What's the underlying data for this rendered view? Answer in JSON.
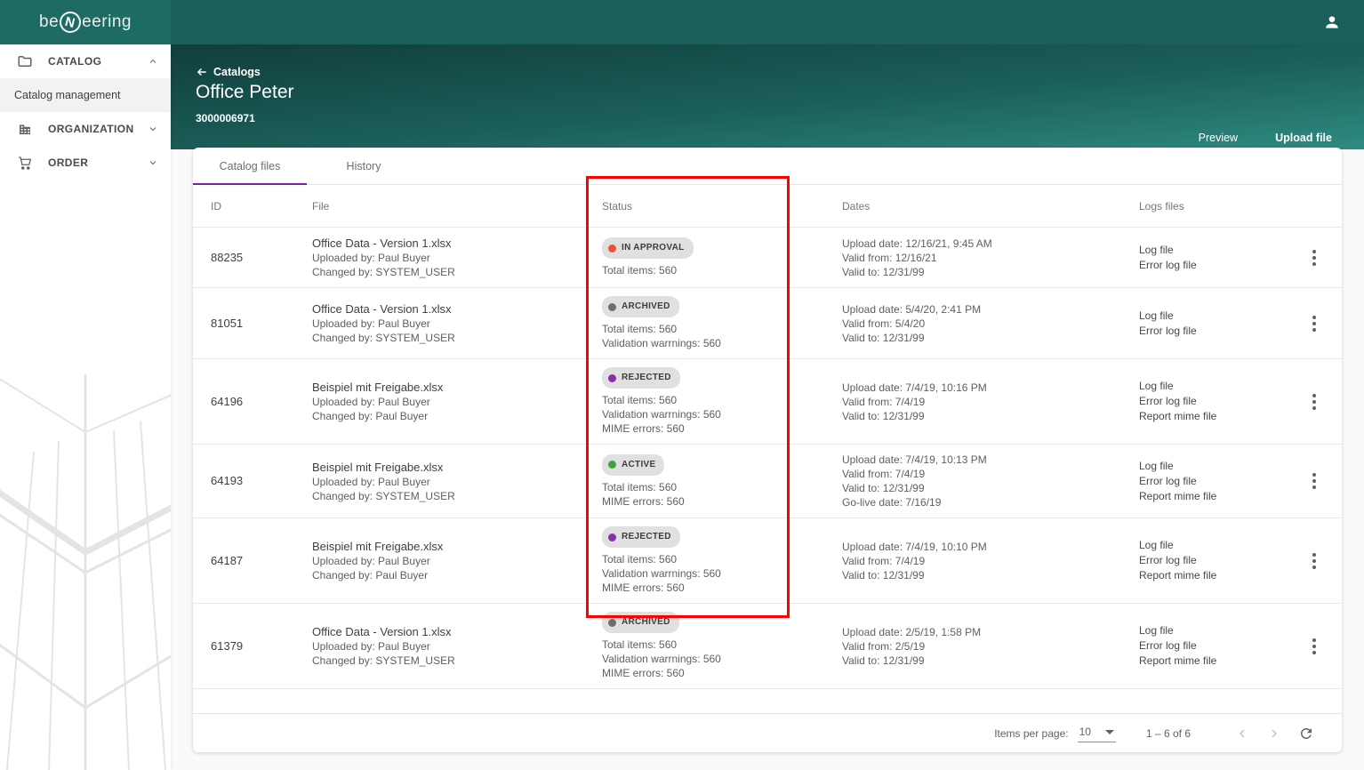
{
  "topbar": {
    "logo_pre": "be",
    "logo_mid": "N",
    "logo_post": "eering"
  },
  "sidebar": {
    "items": [
      {
        "label": "CATALOG",
        "icon": "folder-icon",
        "expanded": true
      },
      {
        "label": "Catalog management",
        "selected": true
      },
      {
        "label": "ORGANIZATION",
        "icon": "building-icon",
        "expanded": false
      },
      {
        "label": "ORDER",
        "icon": "cart-icon",
        "expanded": false
      }
    ]
  },
  "header": {
    "back_label": "Catalogs",
    "title": "Office Peter",
    "subtitle": "3000006971",
    "preview_label": "Preview",
    "upload_label": "Upload file"
  },
  "tabs": {
    "catalog_files": "Catalog files",
    "history": "History"
  },
  "table": {
    "columns": {
      "id": "ID",
      "file": "File",
      "status": "Status",
      "dates": "Dates",
      "logs": "Logs files"
    },
    "rows": [
      {
        "id": "88235",
        "file_name": "Office Data - Version 1.xlsx",
        "uploaded_by": "Uploaded by: Paul Buyer",
        "changed_by": "Changed by: SYSTEM_USER",
        "status_label": "IN APPROVAL",
        "status_color": "#E8542F",
        "status_details": [
          "Total items: 560"
        ],
        "dates": [
          "Upload date: 12/16/21, 9:45 AM",
          "Valid from: 12/16/21",
          "Valid to: 12/31/99"
        ],
        "logs": [
          "Log file",
          "Error log file"
        ]
      },
      {
        "id": "81051",
        "file_name": "Office Data - Version 1.xlsx",
        "uploaded_by": "Uploaded by: Paul Buyer",
        "changed_by": "Changed by: SYSTEM_USER",
        "status_label": "ARCHIVED",
        "status_color": "#6E6E6E",
        "status_details": [
          "Total items: 560",
          "Validation warrnings: 560"
        ],
        "dates": [
          "Upload date: 5/4/20, 2:41 PM",
          "Valid from: 5/4/20",
          "Valid to: 12/31/99"
        ],
        "logs": [
          "Log file",
          "Error log file"
        ]
      },
      {
        "id": "64196",
        "file_name": "Beispiel mit Freigabe.xlsx",
        "uploaded_by": "Uploaded by: Paul Buyer",
        "changed_by": "Changed by: Paul Buyer",
        "status_label": "REJECTED",
        "status_color": "#8B2FA8",
        "status_details": [
          "Total items: 560",
          "Validation warrnings: 560",
          "MIME errors: 560"
        ],
        "dates": [
          "Upload date: 7/4/19, 10:16 PM",
          "Valid from: 7/4/19",
          "Valid to: 12/31/99"
        ],
        "logs": [
          "Log file",
          "Error log file",
          "Report mime file"
        ]
      },
      {
        "id": "64193",
        "file_name": "Beispiel mit Freigabe.xlsx",
        "uploaded_by": "Uploaded by: Paul Buyer",
        "changed_by": "Changed by: SYSTEM_USER",
        "status_label": "ACTIVE",
        "status_color": "#3BA33F",
        "status_details": [
          "Total items: 560",
          "MIME errors: 560"
        ],
        "dates": [
          "Upload date: 7/4/19, 10:13 PM",
          "Valid from: 7/4/19",
          "Valid to: 12/31/99",
          "Go-live date: 7/16/19"
        ],
        "logs": [
          "Log file",
          "Error log file",
          "Report mime file"
        ]
      },
      {
        "id": "64187",
        "file_name": "Beispiel mit Freigabe.xlsx",
        "uploaded_by": "Uploaded by: Paul Buyer",
        "changed_by": "Changed by: Paul Buyer",
        "status_label": "REJECTED",
        "status_color": "#8B2FA8",
        "status_details": [
          "Total items: 560",
          "Validation warrnings: 560",
          "MIME errors: 560"
        ],
        "dates": [
          "Upload date: 7/4/19, 10:10 PM",
          "Valid from: 7/4/19",
          "Valid to: 12/31/99"
        ],
        "logs": [
          "Log file",
          "Error log file",
          "Report mime file"
        ]
      },
      {
        "id": "61379",
        "file_name": "Office Data - Version 1.xlsx",
        "uploaded_by": "Uploaded by: Paul Buyer",
        "changed_by": "Changed by: SYSTEM_USER",
        "status_label": "ARCHIVED",
        "status_color": "#6E6E6E",
        "status_details": [
          "Total items: 560",
          "Validation warrnings: 560",
          "MIME errors: 560"
        ],
        "dates": [
          "Upload date: 2/5/19, 1:58 PM",
          "Valid from: 2/5/19",
          "Valid to: 12/31/99"
        ],
        "logs": [
          "Log file",
          "Error log file",
          "Report mime file"
        ]
      }
    ]
  },
  "footer": {
    "items_per_page_label": "Items per page:",
    "items_per_page_value": "10",
    "range_label": "1 – 6 of 6"
  },
  "colors": {
    "accent_tab": "#7B1FA2",
    "annotation": "#FF0000",
    "status_in_approval": "#E8542F",
    "status_archived": "#6E6E6E",
    "status_rejected": "#8B2FA8",
    "status_active": "#3BA33F"
  }
}
